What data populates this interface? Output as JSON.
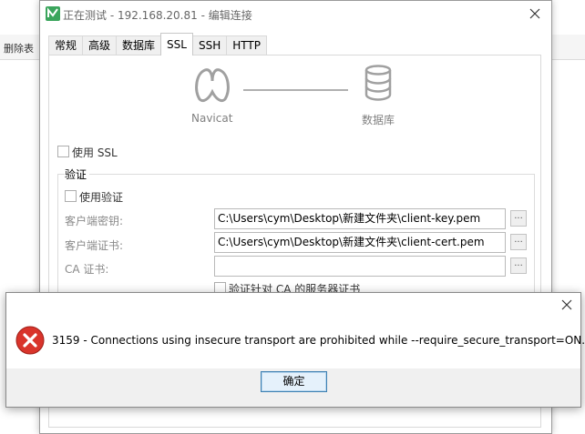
{
  "background": {
    "toolbar_label": "删除表"
  },
  "connection_window": {
    "title": "正在测试 - 192.168.20.81 - 编辑连接",
    "tabs": [
      {
        "label": "常规"
      },
      {
        "label": "高级"
      },
      {
        "label": "数据库"
      },
      {
        "label": "SSL",
        "active": true
      },
      {
        "label": "SSH"
      },
      {
        "label": "HTTP"
      }
    ],
    "diagram": {
      "left_label": "Navicat",
      "right_label": "数据库"
    },
    "use_ssl": {
      "label": "使用 SSL",
      "checked": false
    },
    "auth_group": {
      "title": "验证",
      "use_auth": {
        "label": "使用验证",
        "checked": false
      },
      "client_key": {
        "label": "客户端密钥:",
        "value": "C:\\Users\\cym\\Desktop\\新建文件夹\\client-key.pem",
        "browse": "..."
      },
      "client_cert": {
        "label": "客户端证书:",
        "value": "C:\\Users\\cym\\Desktop\\新建文件夹\\client-cert.pem",
        "browse": "..."
      },
      "ca_cert": {
        "label": "CA 证书:",
        "value": "",
        "browse": "..."
      },
      "verify_ca": {
        "label": "验证针对 CA 的服务器证书",
        "checked": false
      }
    }
  },
  "error_dialog": {
    "message": "3159 - Connections using insecure transport are prohibited while --require_secure_transport=ON.",
    "ok_label": "确定"
  },
  "colors": {
    "accent": "#3c7fb1",
    "error_red": "#d9342b",
    "navicat_green": "#3ba55c"
  }
}
